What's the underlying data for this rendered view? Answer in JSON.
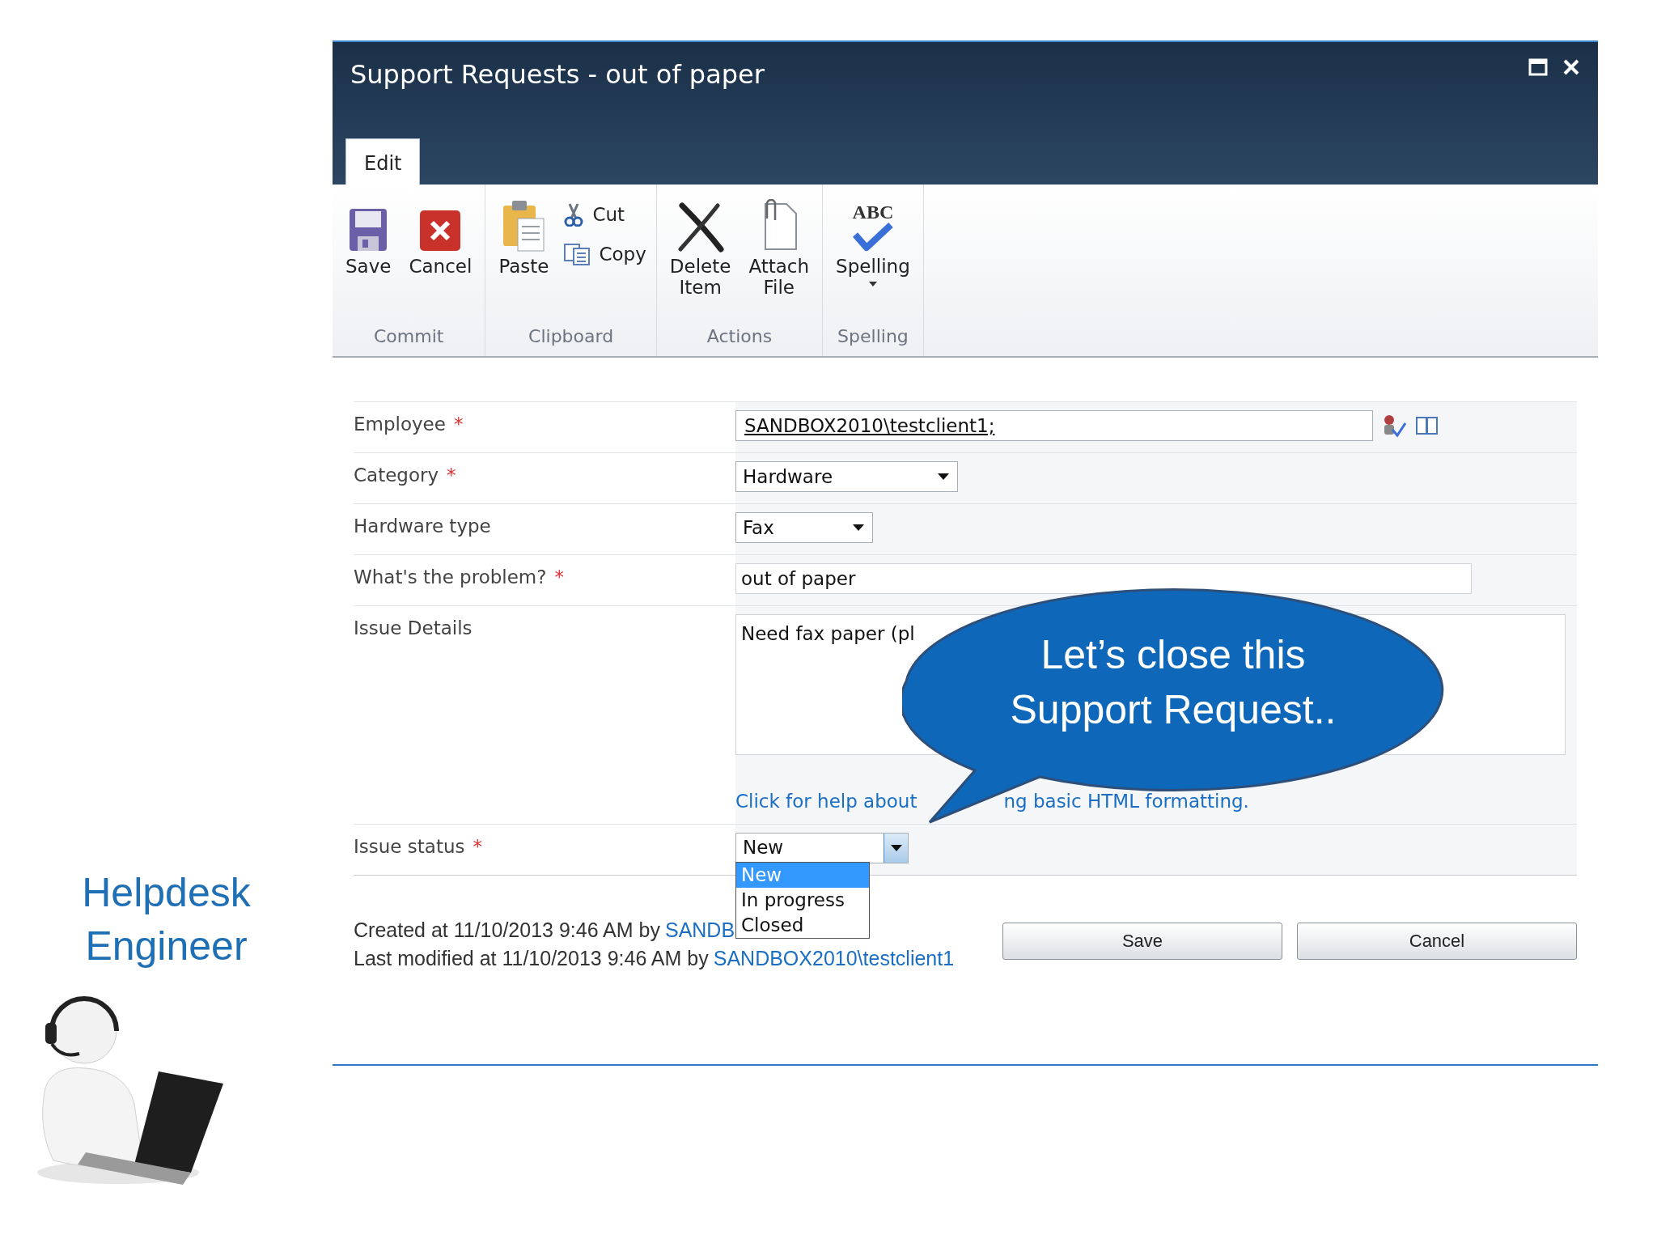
{
  "slide": {
    "caption_lines": [
      "Helpdesk",
      "Engineer"
    ],
    "callout_lines": [
      "Let’s close this",
      "Support Request.."
    ]
  },
  "dialog": {
    "title": "Support Requests - out of paper",
    "tabs": [
      {
        "label": "Edit",
        "selected": true
      }
    ],
    "ribbon_groups": [
      {
        "label": "Commit",
        "buttons": [
          {
            "label": "Save",
            "kind": "large"
          },
          {
            "label": "Cancel",
            "kind": "large"
          }
        ]
      },
      {
        "label": "Clipboard",
        "buttons": [
          {
            "label": "Paste",
            "kind": "large"
          },
          {
            "label": "Cut",
            "kind": "small"
          },
          {
            "label": "Copy",
            "kind": "small"
          }
        ]
      },
      {
        "label": "Actions",
        "buttons": [
          {
            "label": "Delete Item",
            "kind": "large"
          },
          {
            "label": "Attach File",
            "kind": "large"
          }
        ]
      },
      {
        "label": "Spelling",
        "buttons": [
          {
            "label": "Spelling",
            "kind": "menu",
            "icon_text": "ABC"
          }
        ]
      }
    ],
    "fields": [
      {
        "label": "Employee",
        "marker": "*",
        "kind": "people",
        "value": "SANDBOX2010\\testclient1;"
      },
      {
        "label": "Category",
        "marker": "*",
        "kind": "select",
        "value": "Hardware",
        "expanded": false
      },
      {
        "label": "Hardware type",
        "kind": "select",
        "value": "Fax",
        "expanded": false
      },
      {
        "label": "What's the problem?",
        "marker": "*",
        "kind": "text",
        "value": "out of paper"
      },
      {
        "label": "Issue Details",
        "kind": "richtext",
        "value": "Need fax paper (pl",
        "help_parts": [
          "Click for help about",
          "ng basic HTML formatting."
        ]
      },
      {
        "label": "Issue status",
        "marker": "*",
        "kind": "select",
        "value": "New",
        "expanded": true,
        "options": [
          {
            "label": "New",
            "selected": true
          },
          {
            "label": "In progress",
            "selected": false
          },
          {
            "label": "Closed",
            "selected": false
          }
        ]
      }
    ],
    "footer": {
      "created": "Created at 11/10/2013 9:46 AM by",
      "created_by": "SANDB",
      "modified": "Last modified at 11/10/2013 9:46 AM by",
      "modified_by": "SANDBOX2010\\testclient1"
    },
    "buttons": [
      "Save",
      "Cancel"
    ]
  }
}
